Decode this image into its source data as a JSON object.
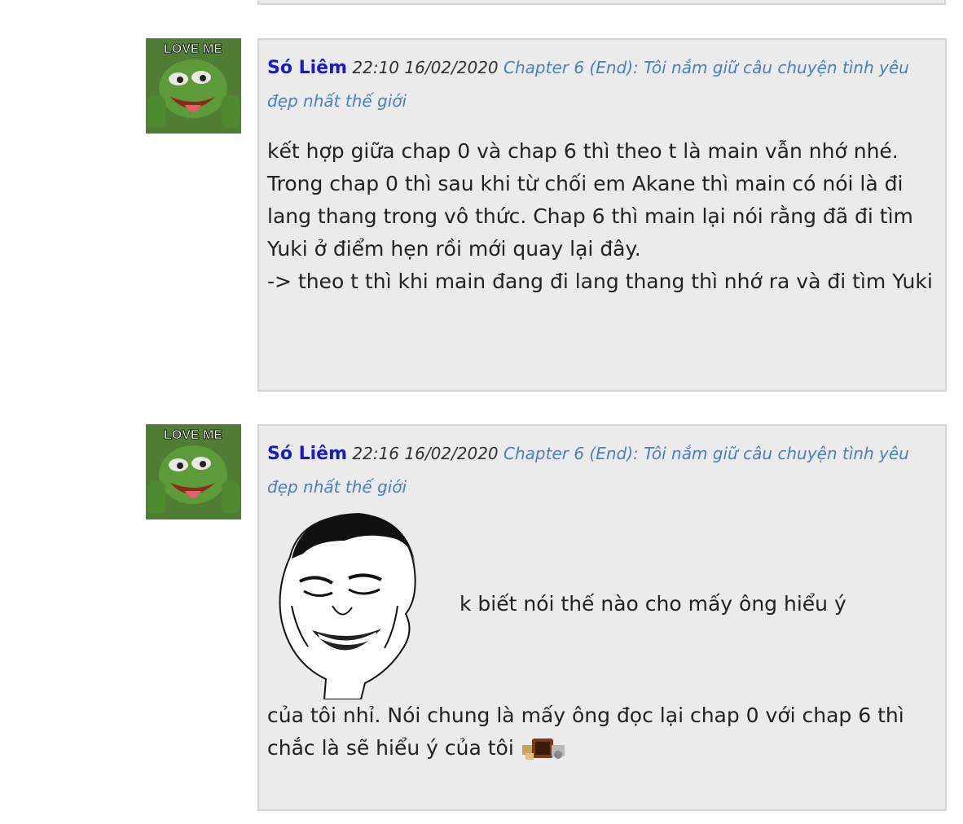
{
  "comments": [
    {
      "author": "Só Liêm",
      "time": "22:10 16/02/2020",
      "chapter": "Chapter 6 (End): Tôi nắm giữ câu chuyện tình yêu đẹp nhất thế giới",
      "avatar_icon": "pepe-love-me-avatar",
      "avatar_caption": "LOVE ME",
      "lines": [
        "kết hợp giữa chap 0 và chap 6 thì theo t là main vẫn nhớ nhé.",
        "Trong chap 0 thì sau khi từ chối em Akane thì main có nói là đi lang thang trong vô thức. Chap 6 thì main lại nói rằng đã đi tìm Yuki ở điểm hẹn rồi mới quay lại đây.",
        "-> theo t thì khi main đang đi lang thang thì nhớ ra và đi tìm Yuki"
      ]
    },
    {
      "author": "Só Liêm",
      "time": "22:16 16/02/2020",
      "chapter": "Chapter 6 (End): Tôi nắm giữ câu chuyện tình yêu đẹp nhất thế giới",
      "avatar_icon": "pepe-love-me-avatar",
      "avatar_caption": "LOVE ME",
      "meme_icon": "yao-ming-laughing-face",
      "meme_text": "k biết nói thế nào cho mấy ông hiểu ý",
      "tail_text": "của tôi nhỉ. Nói chung là mấy ông đọc lại chap 0 với chap 6 thì chắc là sẽ hiểu ý của tôi",
      "emoji_icon": "pixel-emoji-icon"
    }
  ],
  "colors": {
    "author": "#1a1ac8",
    "chapter_link": "#4a7fc0",
    "bubble_bg": "#ebebeb",
    "bubble_border": "#d4d4d4"
  }
}
